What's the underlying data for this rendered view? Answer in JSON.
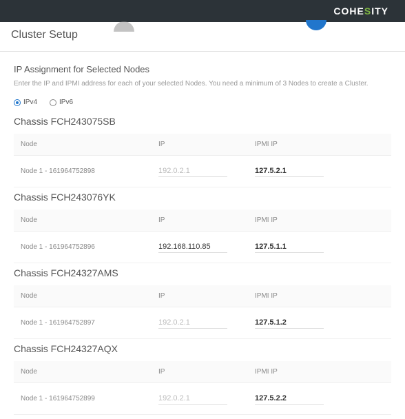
{
  "brand": {
    "pre": "COHE",
    "s": "S",
    "post": "ITY"
  },
  "page_title": "Cluster Setup",
  "section": {
    "title": "IP Assignment for Selected Nodes",
    "description": "Enter the IP and IPMI address for each of your selected Nodes.  You need a minimum of 3 Nodes to create a Cluster."
  },
  "ip_toggle": {
    "ipv4": "IPv4",
    "ipv6": "IPv6",
    "selected": "ipv4"
  },
  "columns": {
    "node": "Node",
    "ip": "IP",
    "ipmi": "IPMI IP"
  },
  "ip_placeholder": "192.0.2.1",
  "chassis": [
    {
      "title": "Chassis FCH243075SB",
      "nodes": [
        {
          "label": "Node 1 - 161964752898",
          "ip": "",
          "ipmi": "127.5.2.1"
        }
      ]
    },
    {
      "title": "Chassis FCH243076YK",
      "nodes": [
        {
          "label": "Node 1 - 161964752896",
          "ip": "192.168.110.85",
          "ipmi": "127.5.1.1"
        }
      ]
    },
    {
      "title": "Chassis FCH24327AMS",
      "nodes": [
        {
          "label": "Node 1 - 161964752897",
          "ip": "",
          "ipmi": "127.5.1.2"
        }
      ]
    },
    {
      "title": "Chassis FCH24327AQX",
      "nodes": [
        {
          "label": "Node 1 - 161964752899",
          "ip": "",
          "ipmi": "127.5.2.2"
        }
      ]
    }
  ]
}
